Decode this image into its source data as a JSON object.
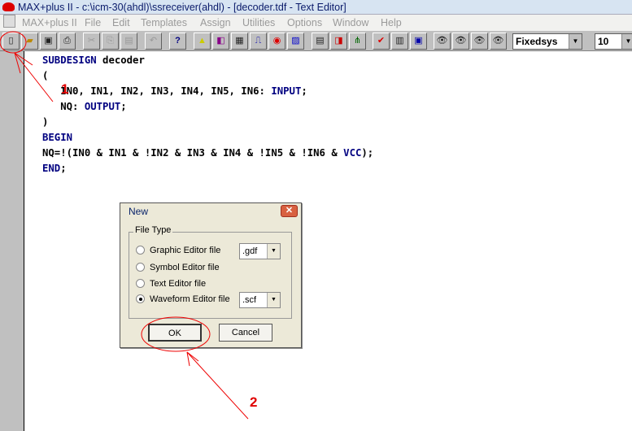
{
  "window": {
    "title": "MAX+plus II - c:\\icm-30(ahdl)\\ssreceiver(ahdl) - [decoder.tdf - Text Editor]"
  },
  "menu": [
    "MAX+plus II",
    "File",
    "Edit",
    "Templates",
    "Assign",
    "Utilities",
    "Options",
    "Window",
    "Help"
  ],
  "toolbar": {
    "font": "Fixedsys",
    "size": "10"
  },
  "code": {
    "l1a": "SUBDESIGN",
    " l1b": "",
    "l1c": " decoder",
    "l2": "(",
    "l3a": "   IN0, IN1, IN2, IN3, IN4, IN5, IN6: ",
    "l3b": "INPUT",
    "l3c": ";",
    "l4a": "   NQ: ",
    "l4b": "OUTPUT",
    "l4c": ";",
    "l5": ")",
    "l6": "BEGIN",
    "l7a": "NQ=!(IN0 & IN1 & !IN2 & IN3 & IN4 & !IN5 & !IN6 & ",
    "l7b": "VCC",
    "l7c": ");",
    "l8a": "END",
    "l8b": ";"
  },
  "dialog": {
    "title": "New",
    "group": "File Type",
    "options": [
      "Graphic Editor file",
      "Symbol Editor file",
      "Text Editor file",
      "Waveform Editor file"
    ],
    "selected": "Waveform Editor file",
    "gdf": ".gdf",
    "scf": ".scf",
    "ok": "OK",
    "cancel": "Cancel"
  },
  "annotations": {
    "a1": "1",
    "a2": "2"
  }
}
